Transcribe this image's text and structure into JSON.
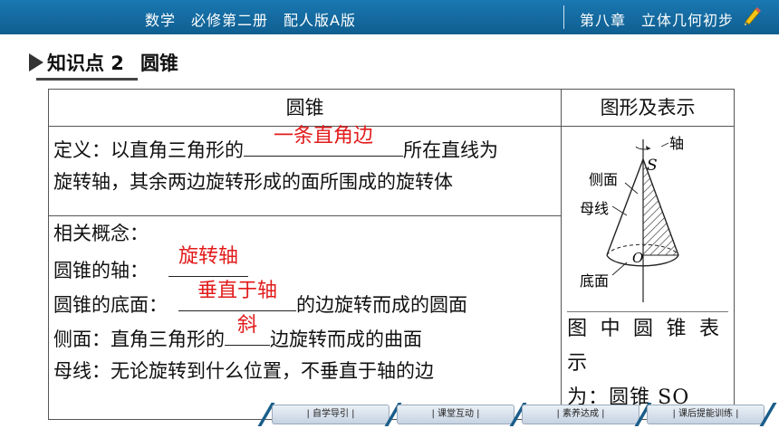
{
  "header": {
    "left_text": "数学　必修第二册　配人版A版",
    "right_text": "第八章　立体几何初步"
  },
  "section": {
    "label": "知识点 2",
    "title": "圆锥"
  },
  "table": {
    "col1_header": "圆锥",
    "col2_header": "图形及表示",
    "def_prefix": "定义：以直角三角形的",
    "def_answer": "一条直角边",
    "def_suffix": "所在直线为",
    "def_line2": "旋转轴，其余两边旋转形成的面所围成的旋转体",
    "concepts_title": "相关概念：",
    "axis_label": "圆锥的轴：",
    "axis_answer": "旋转轴",
    "base_label": "圆锥的底面：",
    "base_answer": "垂直于轴",
    "base_suffix": "的边旋转而成的圆面",
    "lateral_label": "侧面：直角三角形的",
    "lateral_answer": "斜",
    "lateral_suffix": "边旋转而成的曲面",
    "generatrix": "母线：无论旋转到什么位置，不垂直于轴的边",
    "figure_caption_1": "图中圆锥表示",
    "figure_caption_2": "为：圆锥 SO"
  },
  "figure": {
    "label_axis": "轴",
    "label_s": "S",
    "label_lateral": "侧面",
    "label_generatrix": "母线",
    "label_o": "O",
    "label_base": "底面"
  },
  "nav": {
    "items": [
      "| 自学导引 |",
      "| 课堂互动 |",
      "| 素养达成 |",
      "| 课后提能训练 |"
    ]
  }
}
